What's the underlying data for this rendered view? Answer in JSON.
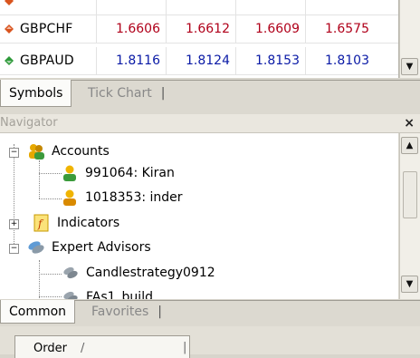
{
  "market_watch": {
    "rows": [
      {
        "symbol": "GBPCHF",
        "direction": "down",
        "values": [
          "1.6606",
          "1.6612",
          "1.6609",
          "1.6575"
        ],
        "color": "#b0001a"
      },
      {
        "symbol": "GBPAUD",
        "direction": "up",
        "values": [
          "1.8116",
          "1.8124",
          "1.8153",
          "1.8103"
        ],
        "color": "#0a1aa6"
      }
    ]
  },
  "market_tabs": {
    "symbols": "Symbols",
    "tick_chart": "Tick Chart"
  },
  "navigator": {
    "title": "Navigator",
    "close": "×",
    "tree": {
      "accounts": "Accounts",
      "account_1": "991064: Kiran",
      "account_2": "1018353: inder",
      "indicators": "Indicators",
      "expert_advisors": "Expert Advisors",
      "ea_1": "Candlestrategy0912",
      "ea_2": "FAs1_build"
    }
  },
  "navigator_tabs": {
    "common": "Common",
    "favorites": "Favorites"
  },
  "bottom": {
    "order_tab": "Order"
  },
  "icons": {
    "down_arrow": "#d9541e",
    "up_arrow": "#2e9a3a",
    "scroll_up": "▲",
    "scroll_down": "▼"
  }
}
